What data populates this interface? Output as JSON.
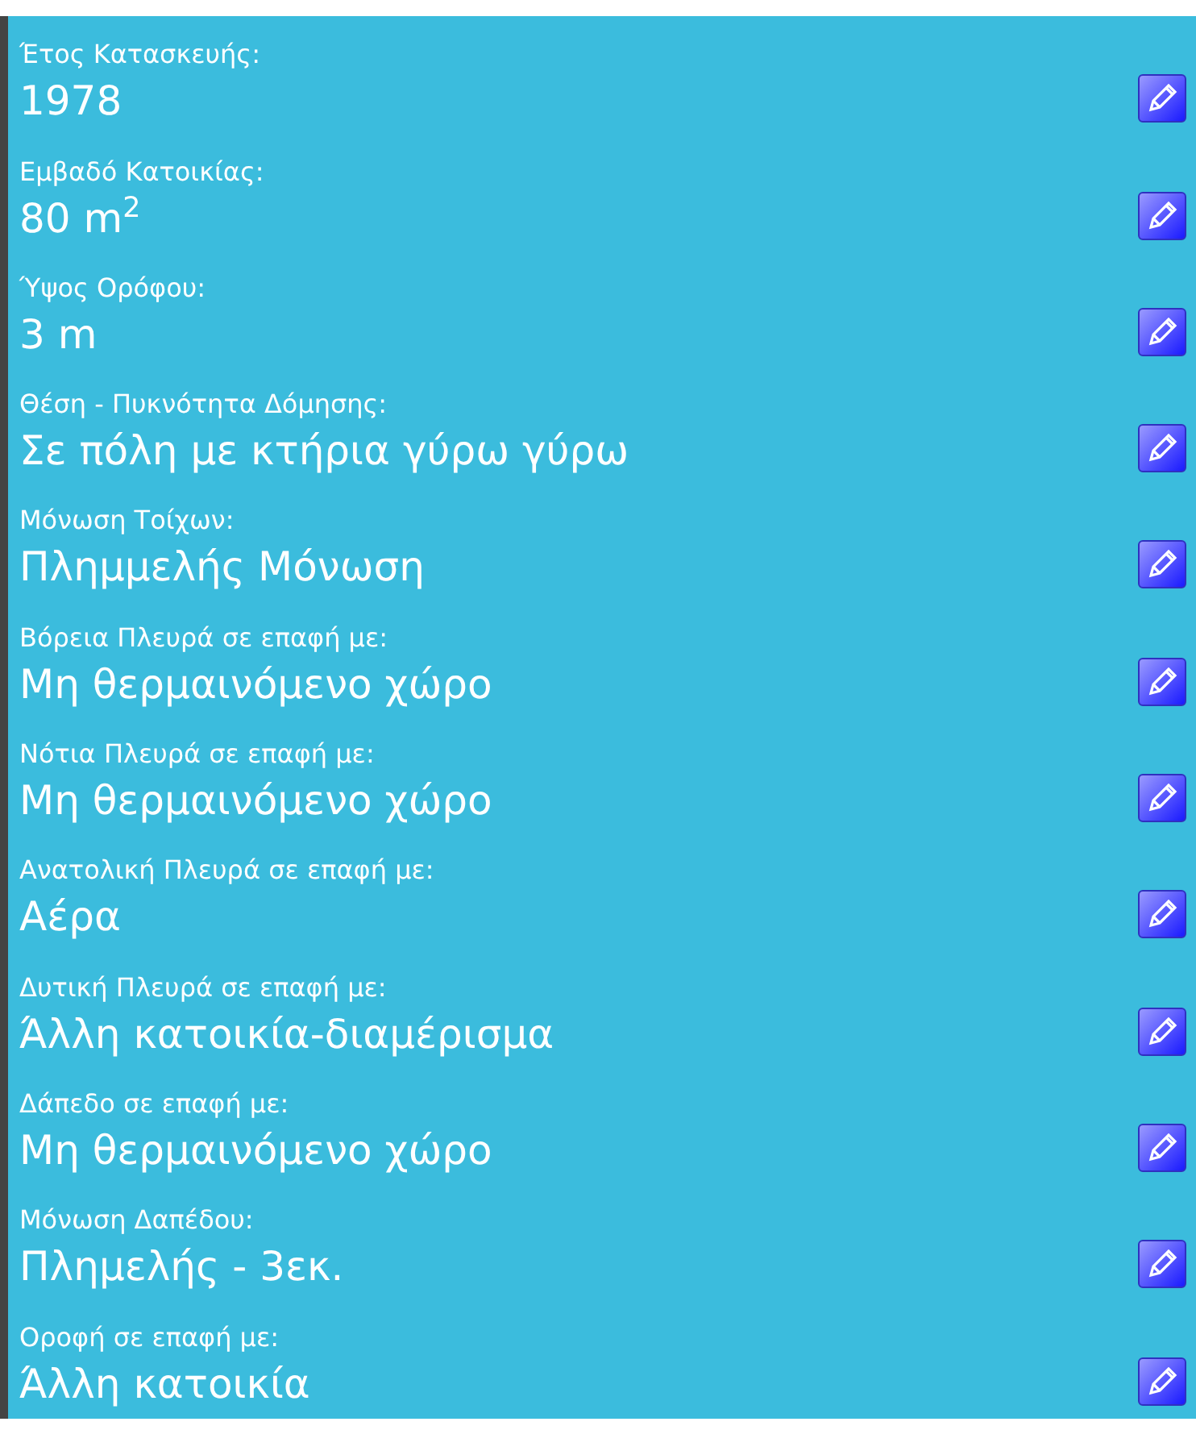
{
  "fields": [
    {
      "label": "Έτος Κατασκευής:",
      "value": "1978"
    },
    {
      "label": "Εμβαδό Κατοικίας:",
      "value": "80 m$^{2}$"
    },
    {
      "label": "Ύψος Ορόφου:",
      "value": "3 m"
    },
    {
      "label": "Θέση - Πυκνότητα Δόμησης:",
      "value": "Σε πόλη με κτήρια γύρω γύρω"
    },
    {
      "label": "Μόνωση Τοίχων:",
      "value": "Πλημμελής Μόνωση"
    },
    {
      "label": "Βόρεια Πλευρά σε επαφή με:",
      "value": "Μη θερμαινόμενο χώρο"
    },
    {
      "label": "Νότια Πλευρά σε επαφή με:",
      "value": "Μη θερμαινόμενο χώρο"
    },
    {
      "label": "Ανατολική Πλευρά σε επαφή με:",
      "value": "Αέρα"
    },
    {
      "label": "Δυτική Πλευρά σε επαφή με:",
      "value": "Άλλη κατοικία-διαμέρισμα"
    },
    {
      "label": "Δάπεδο σε επαφή με:",
      "value": "Μη θερμαινόμενο χώρο"
    },
    {
      "label": "Μόνωση Δαπέδου:",
      "value": "Πλημελής - 3εκ."
    },
    {
      "label": "Οροφή σε επαφή με:",
      "value": "Άλλη κατοικία"
    }
  ]
}
